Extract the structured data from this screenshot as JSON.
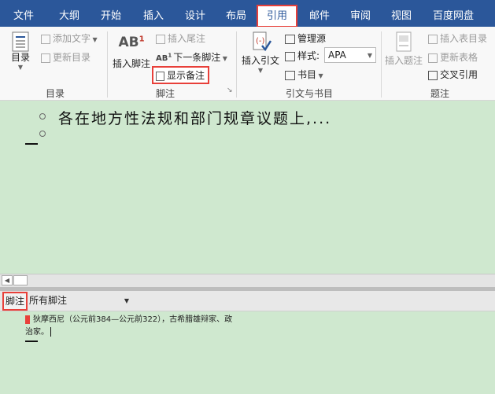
{
  "tabs": [
    "文件",
    "大纲",
    "开始",
    "插入",
    "设计",
    "布局",
    "引用",
    "邮件",
    "审阅",
    "视图",
    "百度网盘"
  ],
  "active_tab": "引用",
  "ribbon": {
    "toc": {
      "big_label": "目录",
      "add_text": "添加文字",
      "update_toc": "更新目录",
      "group": "目录"
    },
    "footnotes": {
      "insert_footnote": "插入脚注",
      "insert_endnote": "插入尾注",
      "next_footnote": "下一条脚注",
      "show_notes": "显示备注",
      "group": "脚注"
    },
    "citations": {
      "insert_citation": "插入引文",
      "manage_sources": "管理源",
      "style_label": "样式:",
      "style_value": "APA",
      "bibliography": "书目",
      "group": "引文与书目"
    },
    "captions": {
      "insert_caption": "插入题注",
      "insert_table_of_figures": "插入表目录",
      "update_table": "更新表格",
      "cross_reference": "交叉引用",
      "group": "题注"
    }
  },
  "document": {
    "line1": "各在地方性法规和部门规章议题上,..."
  },
  "footnote_pane": {
    "label": "脚注",
    "dropdown_value": "所有脚注",
    "note_line1": "狄摩西尼（公元前384—公元前322），古希腊雄辩家、政",
    "note_line2": "治家。"
  },
  "colors": {
    "tabbar": "#2b579a",
    "highlight_border": "#e8403a",
    "doc_background": "#cfe8cf"
  }
}
